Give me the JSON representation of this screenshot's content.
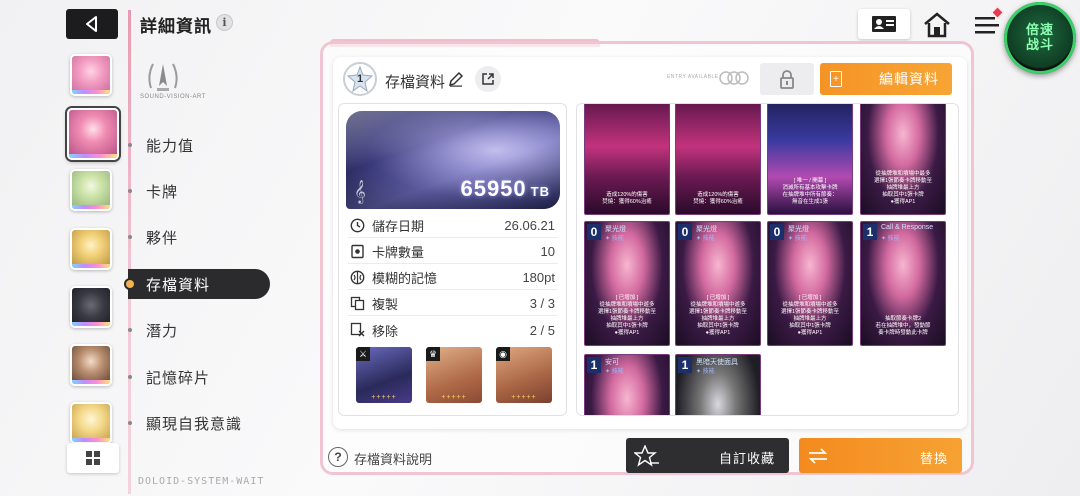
{
  "header": {
    "title": "詳細資訊",
    "info_symbol": "i",
    "speed_button": [
      "倍速",
      "战斗"
    ]
  },
  "sidebar": {
    "logo_text": "SOUND-VISION-ART",
    "menu": [
      {
        "label": "能力值",
        "active": false
      },
      {
        "label": "卡牌",
        "active": false
      },
      {
        "label": "夥伴",
        "active": false
      },
      {
        "label": "存檔資料",
        "active": true
      },
      {
        "label": "潛力",
        "active": false
      },
      {
        "label": "記憶碎片",
        "active": false
      },
      {
        "label": "顯現自我意識",
        "active": false
      }
    ],
    "bottom_code": "DOLOID-SYSTEM-WAIT"
  },
  "panel": {
    "level": "1",
    "title": "存檔資料",
    "tiny_label": "ENTRY AVAILABLE",
    "edit_button": "編輯資料",
    "tb_value": "65950",
    "tb_unit": "TB",
    "stats": [
      {
        "key": "儲存日期",
        "value": "26.06.21",
        "icon": "clock-icon"
      },
      {
        "key": "卡牌數量",
        "value": "10",
        "icon": "card-icon"
      },
      {
        "key": "模糊的記憶",
        "value": "180pt",
        "icon": "brain-icon"
      },
      {
        "key": "複製",
        "value": "3 / 3",
        "icon": "copy-icon"
      },
      {
        "key": "移除",
        "value": "2 / 5",
        "icon": "remove-icon"
      }
    ],
    "gear_tags": [
      "⚔",
      "♛",
      "◉"
    ],
    "gear_stars": "+++++"
  },
  "cards": [
    {
      "cost": "",
      "name": "",
      "sub": "",
      "desc": "造成120%的傷害\n焚燒：獲得60%治癒",
      "bg": "bg-pink"
    },
    {
      "cost": "",
      "name": "",
      "sub": "",
      "desc": "造成120%的傷害\n焚燒：獲得60%治癒",
      "bg": "bg-pink"
    },
    {
      "cost": "",
      "name": "",
      "sub": "",
      "desc": "[ 唯一 / 開幕 ]\n消滅所有基本攻擊卡牌\n在抽牌堆中所有節奏：\n無音在生成1張",
      "bg": "bg-blue"
    },
    {
      "cost": "",
      "name": "",
      "sub": "",
      "desc": "從抽牌堆和墳場中最多\n選擇1張節奏卡牌移動至\n抽牌堆最上方\n抽取其中1張卡牌\n●獲得AP1",
      "bg": "bg-girl"
    },
    {
      "cost": "0",
      "name": "聚光燈",
      "sub": "技能",
      "desc": "[ 已增加 ]\n從抽牌堆和墳場中遊多\n選擇1張節奏卡牌移動至\n抽牌堆最上方\n抽取其中1張卡牌\n●獲得AP1",
      "bg": "bg-girl"
    },
    {
      "cost": "0",
      "name": "聚光燈",
      "sub": "技能",
      "desc": "[ 已增加 ]\n從抽牌堆和墳場中遊多\n選擇1張節奏卡牌移動至\n抽牌堆最上方\n抽取其中1張卡牌\n●獲得AP1",
      "bg": "bg-girl"
    },
    {
      "cost": "0",
      "name": "聚光燈",
      "sub": "技能",
      "desc": "[ 已增加 ]\n從抽牌堆和墳場中遊多\n選擇1張節奏卡牌移動至\n抽牌堆最上方\n抽取其中1張卡牌\n●獲得AP1",
      "bg": "bg-girl"
    },
    {
      "cost": "1",
      "name": "Call & Response",
      "sub": "技能",
      "desc": "抽取節奏卡牌2\n若在抽牌堆中，發動節\n奏卡牌時發動此卡牌",
      "bg": "bg-girl"
    },
    {
      "cost": "1",
      "name": "安可",
      "sub": "技能",
      "desc": "",
      "bg": "bg-girl"
    },
    {
      "cost": "1",
      "name": "黑暗天使面具",
      "sub": "技能",
      "desc": "",
      "bg": "bg-dark"
    }
  ],
  "footer": {
    "help_symbol": "?",
    "help_text": "存檔資料說明",
    "custom_button": "自訂收藏",
    "replace_button": "替換"
  },
  "colors": {
    "accent_orange": "#f59425",
    "dark_button": "#2e2e30",
    "pink_border": "#f0c5d1"
  }
}
